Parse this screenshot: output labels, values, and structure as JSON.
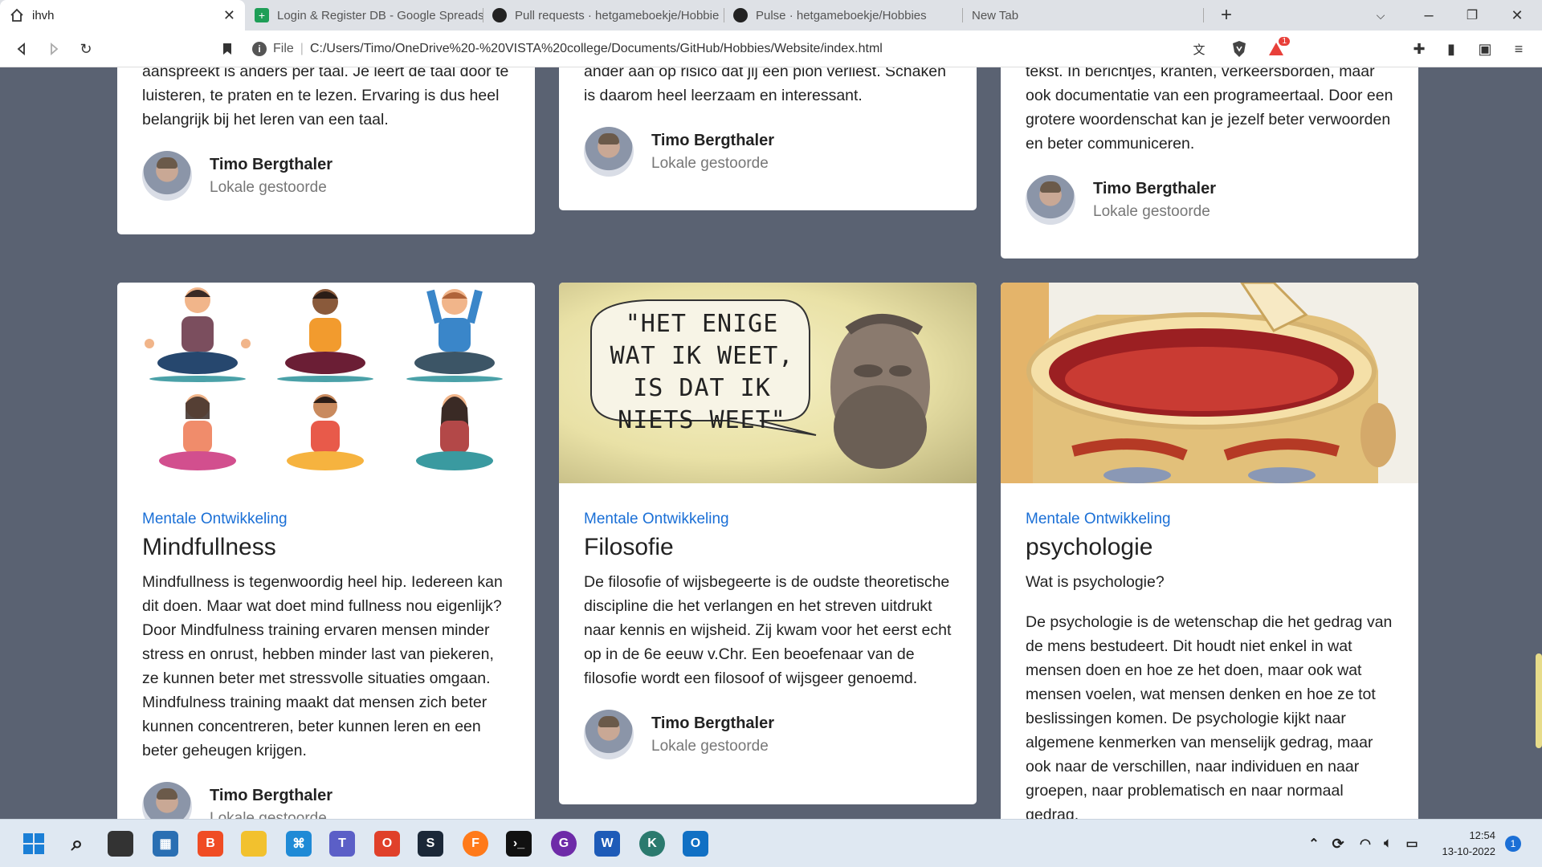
{
  "browser": {
    "tabs": [
      {
        "title": "ihvh"
      },
      {
        "title": "Login & Register DB - Google Spreads"
      },
      {
        "title": "Pull requests · hetgameboekje/Hobbie"
      },
      {
        "title": "Pulse · hetgameboekje/Hobbies"
      },
      {
        "title": "New Tab"
      }
    ],
    "url_label": "File",
    "url": "C:/Users/Timo/OneDrive%20-%20VISTA%20college/Documents/GitHub/Hobbies/Website/index.html",
    "brave_badge": "1"
  },
  "top_cards": [
    {
      "text": "aanspreekt is anders per taal. Je leert de taal door te luisteren, te praten en te lezen. Ervaring is dus heel belangrijk bij het leren van een taal.",
      "author": "Timo Bergthaler",
      "location": "Lokale gestoorde"
    },
    {
      "text": "ander aan op risico dat jij een pion verliest. Schaken is daarom heel leerzaam en interessant.",
      "author": "Timo Bergthaler",
      "location": "Lokale gestoorde"
    },
    {
      "text": "tekst. In berichtjes, kranten, verkeersborden, maar ook documentatie van een programeertaal. Door een grotere woordenschat kan je jezelf beter verwoorden en beter communiceren.",
      "author": "Timo Bergthaler",
      "location": "Lokale gestoorde"
    }
  ],
  "cards": [
    {
      "category": "Mentale Ontwikkeling",
      "title": "Mindfullness",
      "text": "Mindfullness is tegenwoordig heel hip. Iedereen kan dit doen. Maar wat doet mind fullness nou eigenlijk? Door Mindfulness training ervaren mensen minder stress en onrust, hebben minder last van piekeren, ze kunnen beter met stressvolle situaties omgaan. Mindfulness training maakt dat mensen zich beter kunnen concentreren, beter kunnen leren en een beter geheugen krijgen.",
      "author": "Timo Bergthaler",
      "location": "Lokale gestoorde"
    },
    {
      "category": "Mentale Ontwikkeling",
      "title": "Filosofie",
      "text": "De filosofie of wijsbegeerte is de oudste theoretische discipline die het verlangen en het streven uitdrukt naar kennis en wijsheid. Zij kwam voor het eerst echt op in de 6e eeuw v.Chr. Een beoefenaar van de filosofie wordt een filosoof of wijsgeer genoemd.",
      "author": "Timo Bergthaler",
      "location": "Lokale gestoorde",
      "image_quote": "\"HET ENIGE WAT IK WEET, IS DAT IK NIETS WEET\""
    },
    {
      "category": "Mentale Ontwikkeling",
      "title": "psychologie",
      "subtitle": "Wat is psychologie?",
      "text": "De psychologie is de wetenschap die het gedrag van de mens bestudeert. Dit houdt niet enkel in wat mensen doen en hoe ze het doen, maar ook wat mensen voelen, wat mensen denken en hoe ze tot beslissingen komen. De psychologie kijkt naar algemene kenmerken van menselijk gedrag, maar ook naar de verschillen, naar individuen en naar groepen, naar problematisch en naar normaal gedrag."
    }
  ],
  "taskbar": {
    "time": "12:54",
    "date": "13-10-2022",
    "notifications": "1"
  }
}
